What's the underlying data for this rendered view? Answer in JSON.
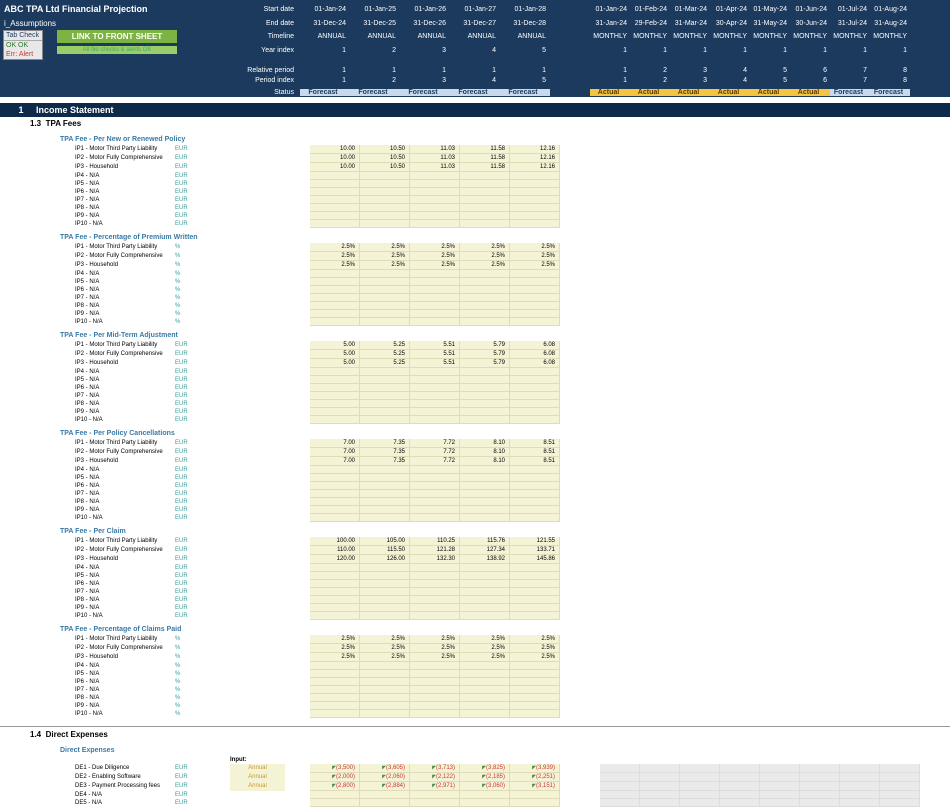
{
  "header": {
    "title": "ABC TPA Ltd Financial Projection",
    "subtitle": "i_Assumptions",
    "link_btn": "LINK TO FRONT SHEET",
    "link_sub": "All file checks & alerts OK",
    "tabcheck": {
      "title": "Tab Check",
      "ok": "OK  OK",
      "err": "Err:  Alert"
    },
    "labels": [
      "Start date",
      "End date",
      "Timeline",
      "Year index",
      "",
      "Relative period",
      "Period index",
      "Status"
    ],
    "annual_dates_start": [
      "01-Jan-24",
      "01-Jan-25",
      "01-Jan-26",
      "01-Jan-27",
      "01-Jan-28"
    ],
    "annual_dates_end": [
      "31-Dec-24",
      "31-Dec-25",
      "31-Dec-26",
      "31-Dec-27",
      "31-Dec-28"
    ],
    "annual_timeline": [
      "ANNUAL",
      "ANNUAL",
      "ANNUAL",
      "ANNUAL",
      "ANNUAL"
    ],
    "annual_yidx": [
      "1",
      "2",
      "3",
      "4",
      "5"
    ],
    "annual_rel": [
      "1",
      "1",
      "1",
      "1",
      "1"
    ],
    "annual_pidx": [
      "1",
      "2",
      "3",
      "4",
      "5"
    ],
    "annual_status": [
      "Forecast",
      "Forecast",
      "Forecast",
      "Forecast",
      "Forecast"
    ],
    "month_dates_start": [
      "01-Jan-24",
      "01-Feb-24",
      "01-Mar-24",
      "01-Apr-24",
      "01-May-24",
      "01-Jun-24",
      "01-Jul-24",
      "01-Aug-24"
    ],
    "month_dates_end": [
      "31-Jan-24",
      "29-Feb-24",
      "31-Mar-24",
      "30-Apr-24",
      "31-May-24",
      "30-Jun-24",
      "31-Jul-24",
      "31-Aug-24"
    ],
    "month_timeline": [
      "MONTHLY",
      "MONTHLY",
      "MONTHLY",
      "MONTHLY",
      "MONTHLY",
      "MONTHLY",
      "MONTHLY",
      "MONTHLY"
    ],
    "month_yidx": [
      "1",
      "1",
      "1",
      "1",
      "1",
      "1",
      "1",
      "1"
    ],
    "month_rel": [
      "1",
      "2",
      "3",
      "4",
      "5",
      "6",
      "7",
      "8"
    ],
    "month_pidx": [
      "1",
      "2",
      "3",
      "4",
      "5",
      "6",
      "7",
      "8"
    ],
    "month_status": [
      "Actual",
      "Actual",
      "Actual",
      "Actual",
      "Actual",
      "Actual",
      "Forecast",
      "Forecast"
    ]
  },
  "section": {
    "num": "1",
    "title": "Income Statement",
    "sub_num": "1.3",
    "sub_title": "TPA Fees",
    "sub2_num": "1.4",
    "sub2_title": "Direct Expenses"
  },
  "items": [
    "IP1 - Motor Third Party Liability",
    "IP2 - Motor Fully Comprehensive",
    "IP3 - Household",
    "IP4 - N/A",
    "IP5 - N/A",
    "IP6 - N/A",
    "IP7 - N/A",
    "IP8 - N/A",
    "IP9 - N/A",
    "IP10 - N/A"
  ],
  "blocks": [
    {
      "title": "TPA Fee - Per New or Renewed Policy",
      "unit": "EUR",
      "vals": [
        [
          "10.00",
          "10.50",
          "11.03",
          "11.58",
          "12.16"
        ],
        [
          "10.00",
          "10.50",
          "11.03",
          "11.58",
          "12.16"
        ],
        [
          "10.00",
          "10.50",
          "11.03",
          "11.58",
          "12.16"
        ],
        [],
        [],
        [],
        [],
        [],
        [],
        []
      ]
    },
    {
      "title": "TPA Fee - Percentage of Premium Written",
      "unit": "%",
      "vals": [
        [
          "2.5%",
          "2.5%",
          "2.5%",
          "2.5%",
          "2.5%"
        ],
        [
          "2.5%",
          "2.5%",
          "2.5%",
          "2.5%",
          "2.5%"
        ],
        [
          "2.5%",
          "2.5%",
          "2.5%",
          "2.5%",
          "2.5%"
        ],
        [],
        [],
        [],
        [],
        [],
        [],
        []
      ]
    },
    {
      "title": "TPA Fee - Per Mid-Term Adjustment",
      "unit": "EUR",
      "vals": [
        [
          "5.00",
          "5.25",
          "5.51",
          "5.79",
          "6.08"
        ],
        [
          "5.00",
          "5.25",
          "5.51",
          "5.79",
          "6.08"
        ],
        [
          "5.00",
          "5.25",
          "5.51",
          "5.79",
          "6.08"
        ],
        [],
        [],
        [],
        [],
        [],
        [],
        []
      ]
    },
    {
      "title": "TPA Fee - Per Policy Cancellations",
      "unit": "EUR",
      "vals": [
        [
          "7.00",
          "7.35",
          "7.72",
          "8.10",
          "8.51"
        ],
        [
          "7.00",
          "7.35",
          "7.72",
          "8.10",
          "8.51"
        ],
        [
          "7.00",
          "7.35",
          "7.72",
          "8.10",
          "8.51"
        ],
        [],
        [],
        [],
        [],
        [],
        [],
        []
      ]
    },
    {
      "title": "TPA Fee - Per Claim",
      "unit": "EUR",
      "vals": [
        [
          "100.00",
          "105.00",
          "110.25",
          "115.76",
          "121.55"
        ],
        [
          "110.00",
          "115.50",
          "121.28",
          "127.34",
          "133.71"
        ],
        [
          "120.00",
          "126.00",
          "132.30",
          "138.92",
          "145.86"
        ],
        [],
        [],
        [],
        [],
        [],
        [],
        []
      ]
    },
    {
      "title": "TPA Fee - Percentage of Claims Paid",
      "unit": "%",
      "vals": [
        [
          "2.5%",
          "2.5%",
          "2.5%",
          "2.5%",
          "2.5%"
        ],
        [
          "2.5%",
          "2.5%",
          "2.5%",
          "2.5%",
          "2.5%"
        ],
        [
          "2.5%",
          "2.5%",
          "2.5%",
          "2.5%",
          "2.5%"
        ],
        [],
        [],
        [],
        [],
        [],
        [],
        []
      ]
    }
  ],
  "expenses": {
    "title": "Direct Expenses",
    "input_label": "Input:",
    "items": [
      {
        "lbl": "DE1 - Due Diligence",
        "unit": "EUR",
        "inp": "Annual",
        "vals": [
          "(3,500)",
          "(3,605)",
          "(3,713)",
          "(3,825)",
          "(3,939)"
        ]
      },
      {
        "lbl": "DE2 - Enabling Software",
        "unit": "EUR",
        "inp": "Annual",
        "vals": [
          "(2,000)",
          "(2,060)",
          "(2,122)",
          "(2,185)",
          "(2,251)"
        ]
      },
      {
        "lbl": "DE3 - Payment Processing fees",
        "unit": "EUR",
        "inp": "Annual",
        "vals": [
          "(2,800)",
          "(2,884)",
          "(2,971)",
          "(3,060)",
          "(3,151)"
        ]
      },
      {
        "lbl": "DE4 - N/A",
        "unit": "EUR",
        "inp": "",
        "vals": []
      },
      {
        "lbl": "DE5 - N/A",
        "unit": "EUR",
        "inp": "",
        "vals": []
      }
    ]
  }
}
